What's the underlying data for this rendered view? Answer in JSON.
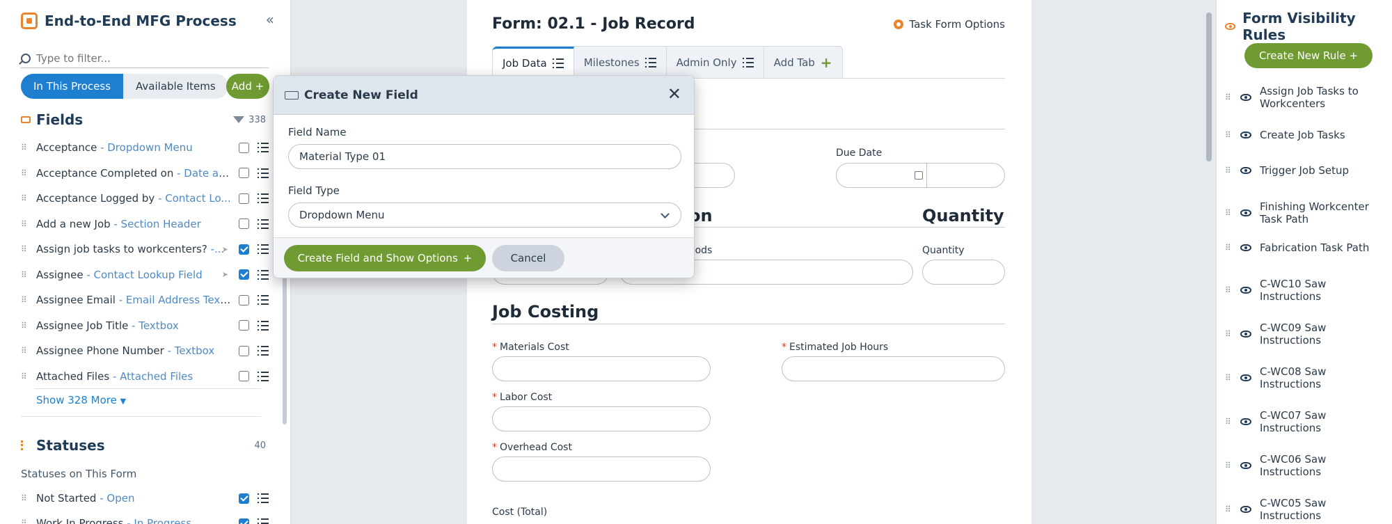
{
  "left": {
    "title": "End-to-End MFG Process",
    "filter_placeholder": "Type to filter...",
    "seg_in_process": "In This Process",
    "seg_available": "Available Items",
    "add_label": "Add +",
    "fields_title": "Fields",
    "fields_count": "338",
    "fields": [
      {
        "name": "Acceptance",
        "type": " - Dropdown Menu",
        "checked": false
      },
      {
        "name": "Acceptance Completed on",
        "type": " - Date an...",
        "checked": false
      },
      {
        "name": "Acceptance Logged by",
        "type": " - Contact Lo...",
        "checked": false
      },
      {
        "name": "Add a new Job",
        "type": " - Section Header",
        "checked": false
      },
      {
        "name": "Assign job tasks to workcenters?",
        "type": " -...",
        "checked": true
      },
      {
        "name": "Assignee",
        "type": " - Contact Lookup Field",
        "checked": true
      },
      {
        "name": "Assignee Email",
        "type": " - Email Address Textb...",
        "checked": false
      },
      {
        "name": "Assignee Job Title",
        "type": " - Textbox",
        "checked": false
      },
      {
        "name": "Assignee Phone Number",
        "type": " - Textbox",
        "checked": false
      },
      {
        "name": "Attached Files",
        "type": " - Attached Files",
        "checked": false
      }
    ],
    "show_more": "Show 328 More",
    "statuses_title": "Statuses",
    "statuses_count": "40",
    "statuses_sub": "Statuses on This Form",
    "statuses": [
      {
        "name": "Not Started",
        "type": " - Open",
        "checked": true
      },
      {
        "name": "Work In Progress",
        "type": " - In Progress",
        "checked": true
      }
    ]
  },
  "form": {
    "title": "Form: 02.1 - Job Record",
    "options": "Task Form Options",
    "tabs": [
      "Job Data",
      "Milestones",
      "Admin Only",
      "Add Tab"
    ],
    "due_date": "Due Date",
    "section_partial": "on",
    "quantity_header": "Quantity",
    "goods_partial": "oods",
    "quantity_label": "Quantity",
    "job_costing": "Job Costing",
    "materials_cost": "Materials Cost",
    "estimated_hours": "Estimated Job Hours",
    "labor_cost": "Labor Cost",
    "overhead_cost": "Overhead Cost",
    "cost_total": "Cost (Total)"
  },
  "modal": {
    "title": "Create New Field",
    "field_name_label": "Field Name",
    "field_name_value": "Material Type 01",
    "field_type_label": "Field Type",
    "field_type_value": "Dropdown Menu",
    "create_btn": "Create Field and Show Options",
    "cancel_btn": "Cancel"
  },
  "right": {
    "title": "Form Visibility Rules",
    "create_rule": "Create New Rule +",
    "rules": [
      "Assign Job Tasks to Workcenters",
      "Create Job Tasks",
      "Trigger Job Setup",
      "Finishing Workcenter Task Path",
      "Fabrication Task Path",
      "C-WC10 Saw Instructions",
      "C-WC09 Saw Instructions",
      "C-WC08 Saw Instructions",
      "C-WC07 Saw Instructions",
      "C-WC06 Saw Instructions",
      "C-WC05 Saw Instructions"
    ]
  },
  "colors": {
    "accent_blue": "#1e7fd1",
    "brand_green": "#6f9b32",
    "brand_orange": "#e8842c"
  }
}
